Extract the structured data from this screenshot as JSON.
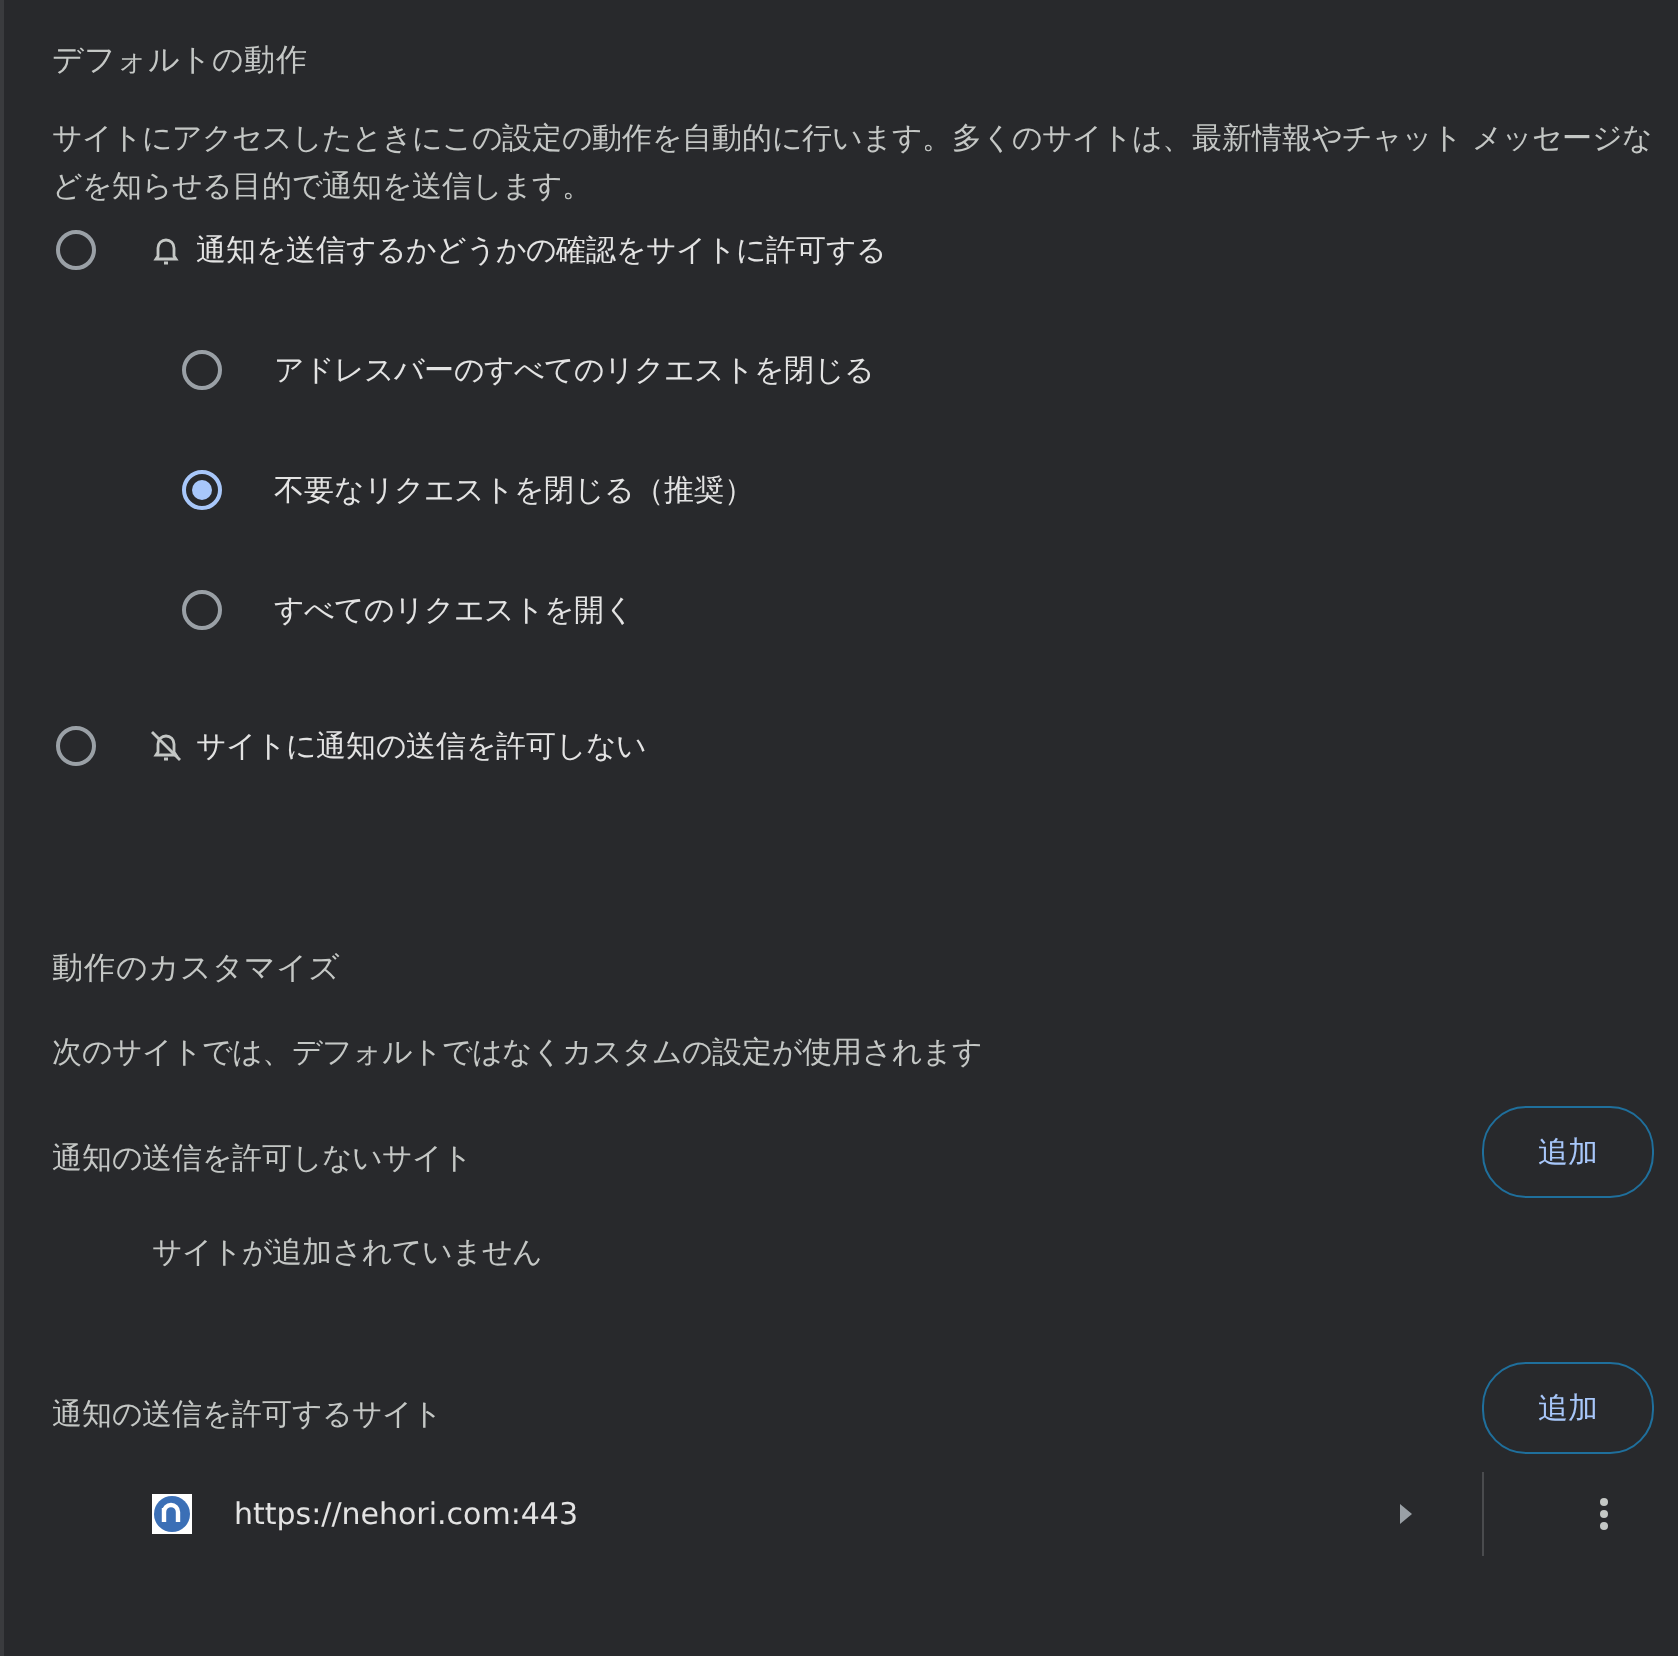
{
  "default_behavior": {
    "title": "デフォルトの動作",
    "description": "サイトにアクセスしたときにこの設定の動作を自動的に行います。多くのサイトは、最新情報やチャット メッセージなどを知らせる目的で通知を送信します。",
    "options": [
      {
        "kind": "allow",
        "label": "通知を送信するかどうかの確認をサイトに許可する",
        "selected": false,
        "children": [
          {
            "label": "アドレスバーのすべてのリクエストを閉じる",
            "selected": false
          },
          {
            "label": "不要なリクエストを閉じる（推奨）",
            "selected": true
          },
          {
            "label": "すべてのリクエストを開く",
            "selected": false
          }
        ]
      },
      {
        "kind": "block",
        "label": "サイトに通知の送信を許可しない",
        "selected": false
      }
    ]
  },
  "customize": {
    "title": "動作のカスタマイズ",
    "description": "次のサイトでは、デフォルトではなくカスタムの設定が使用されます",
    "sections": [
      {
        "title": "通知の送信を許可しないサイト",
        "button": "追加",
        "empty_text": "サイトが追加されていません"
      },
      {
        "title": "通知の送信を許可するサイト",
        "button": "追加",
        "sites": [
          {
            "url": "https://nehori.com:443"
          }
        ]
      }
    ]
  }
}
